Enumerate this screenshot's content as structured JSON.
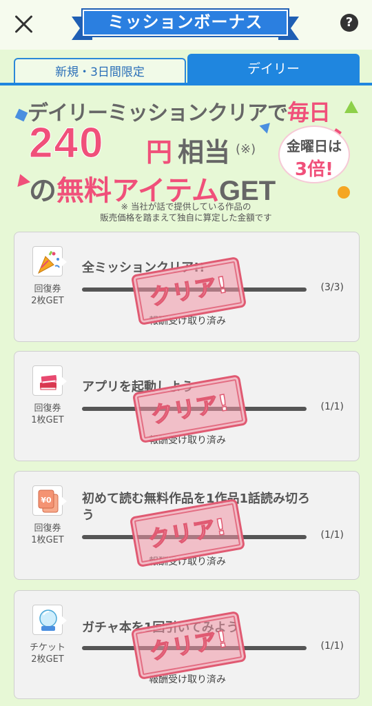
{
  "header": {
    "title": "ミッションボーナス",
    "help_label": "?"
  },
  "tabs": [
    {
      "label": "新規・3日間限定",
      "active": false
    },
    {
      "label": "デイリー",
      "active": true
    }
  ],
  "banner": {
    "line1_prefix": "デイリーミッションクリアで",
    "line1_highlight": "毎日",
    "amount": "240",
    "yen": "円",
    "equiv": "相当",
    "note_mark": "(※)",
    "line3_prefix": "の",
    "line3_highlight": "無料アイテム",
    "line3_suffix": "GET",
    "bubble_line1": "金曜日は",
    "bubble_line2": "3倍!",
    "disclaimer_line1": "※ 当社が話で提供している作品の",
    "disclaimer_line2": "販売価格を踏まえて独自に算定した金額です"
  },
  "missions": [
    {
      "icon": "party-popper-icon",
      "reward_line1": "回復券",
      "reward_line2": "2枚GET",
      "title": "全ミッションクリア!!",
      "count": "(3/3)",
      "status": "報酬受け取り済み",
      "stamp": "クリア!",
      "progress": 1.0
    },
    {
      "icon": "books-icon",
      "reward_line1": "回復券",
      "reward_line2": "1枚GET",
      "title": "アプリを起動しよう",
      "count": "(1/1)",
      "status": "報酬受け取り済み",
      "stamp": "クリア!",
      "progress": 1.0
    },
    {
      "icon": "yen-coin-icon",
      "reward_line1": "回復券",
      "reward_line2": "1枚GET",
      "title": "初めて読む無料作品を1作品1話読み切ろう",
      "count": "(1/1)",
      "status": "報酬受け取り済み",
      "stamp": "クリア!",
      "progress": 1.0
    },
    {
      "icon": "crystal-ball-icon",
      "reward_line1": "チケット",
      "reward_line2": "2枚GET",
      "title": "ガチャ本を1回引いてみよう",
      "count": "(1/1)",
      "status": "報酬受け取り済み",
      "stamp": "クリア!",
      "progress": 1.0
    }
  ],
  "colors": {
    "background": "#e7f8d6",
    "accent_blue": "#1f86df",
    "accent_pink": "#f0507a"
  }
}
